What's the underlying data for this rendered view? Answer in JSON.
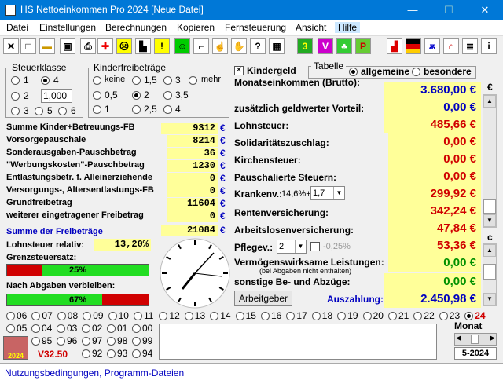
{
  "title": "HS  Nettoeinkommen Pro 2024 [Neue Datei]",
  "menu": [
    "Datei",
    "Einstellungen",
    "Berechnungen",
    "Kopieren",
    "Fernsteuerung",
    "Ansicht",
    "Hilfe"
  ],
  "steuerklasse": {
    "title": "Steuerklasse",
    "options": [
      "1",
      "4",
      "2",
      "3",
      "5",
      "6"
    ],
    "selected": "4",
    "factor": "1,000"
  },
  "kinderfb": {
    "title": "Kinderfreibeträge",
    "options": [
      "keine",
      "1,5",
      "3",
      "mehr",
      "0,5",
      "2",
      "3,5",
      "1",
      "2,5",
      "4"
    ],
    "selected": "2"
  },
  "kindergeld": {
    "label": "Kindergeld",
    "checked": true
  },
  "tabelle": {
    "title": "Tabelle",
    "options": [
      "allgemeine",
      "besondere"
    ],
    "selected": "allgemeine"
  },
  "left_rows": [
    {
      "label": "Summe Kinder+Betreuungs-FB",
      "value": "9312",
      "bold": true
    },
    {
      "label": "Vorsorgepauschale",
      "value": "8214"
    },
    {
      "label": "Sonderausgaben-Pauschbetrag",
      "value": "36"
    },
    {
      "label": "\"Werbungskosten\"-Pauschbetrag",
      "value": "1230"
    },
    {
      "label": "Entlastungsbetr. f. Alleinerziehende",
      "value": "0"
    },
    {
      "label": "Versorgungs-, Altersentlastungs-FB",
      "value": "0"
    },
    {
      "label": "Grundfreibetrag",
      "value": "11604"
    },
    {
      "label": "weiterer eingetragener Freibetrag",
      "value": "0"
    }
  ],
  "euro": "€",
  "summe_freibetraege": {
    "label": "Summe der Freibeträge",
    "value": "21084"
  },
  "lohnsteuer_relativ": {
    "label": "Lohnsteuer relativ:",
    "value": "13,20%"
  },
  "grenzsteuersatz": {
    "label": "Grenzsteuersatz:",
    "value": "25%",
    "fraction": 0.25
  },
  "verbleiben": {
    "label": "Nach Abgaben verbleiben:",
    "value": "67%",
    "fraction": 0.67
  },
  "right_rows": {
    "monatseinkommen": {
      "label": "Monatseinkommen (Brutto):",
      "value": "3.680,00"
    },
    "geldwert": {
      "label": "zusätzlich geldwerter Vorteil:",
      "value": "0,00"
    },
    "lohnsteuer": {
      "label": "Lohnsteuer:",
      "value": "485,66"
    },
    "soli": {
      "label": "Solidaritätszuschlag:",
      "value": "0,00"
    },
    "kirchensteuer": {
      "label": "Kirchensteuer:",
      "value": "0,00"
    },
    "pauschal": {
      "label": "Pauschalierte Steuern:",
      "value": "0,00"
    },
    "kranken": {
      "label": "Krankenv.:",
      "rate": "14,6%+",
      "select": "1,7",
      "value": "299,92"
    },
    "rente": {
      "label": "Rentenversicherung:",
      "value": "342,24"
    },
    "arbeitslos": {
      "label": "Arbeitslosenversicherung:",
      "value": "47,84"
    },
    "pflege": {
      "label": "Pflegev.:",
      "select": "2",
      "extra": "-0,25%",
      "value": "53,36"
    },
    "vwl": {
      "label": "Vermögenswirksame Leistungen:",
      "note": "(bei Abgaben nicht enthalten)",
      "value": "0,00"
    },
    "sonstige": {
      "label": "sonstige Be- und Abzüge:",
      "value": "0,00"
    },
    "auszahlung": {
      "label": "Auszahlung:",
      "value": "2.450,98"
    }
  },
  "arbeitgeber_button": "Arbeitgeber",
  "scroll_labels": {
    "euro": "€",
    "c": "c"
  },
  "years_row1": [
    "06",
    "07",
    "08",
    "09",
    "10",
    "11",
    "12",
    "13",
    "14",
    "15",
    "16",
    "17",
    "18",
    "19",
    "20",
    "21",
    "22",
    "23",
    "24"
  ],
  "years_row2": [
    "05",
    "04",
    "03",
    "02",
    "01",
    "00"
  ],
  "years_row3": [
    "95",
    "96",
    "97",
    "98",
    "99"
  ],
  "years_row4": [
    "92",
    "93",
    "94"
  ],
  "selected_year": "24",
  "version": "V32.50",
  "logo_text": "2024",
  "monat": {
    "label": "Monat",
    "value": "5-2024"
  },
  "status": "Nutzungsbedingungen, Programm-Dateien",
  "colors": {
    "accent": "#0000c0",
    "red": "#d00000",
    "green": "#009000"
  }
}
